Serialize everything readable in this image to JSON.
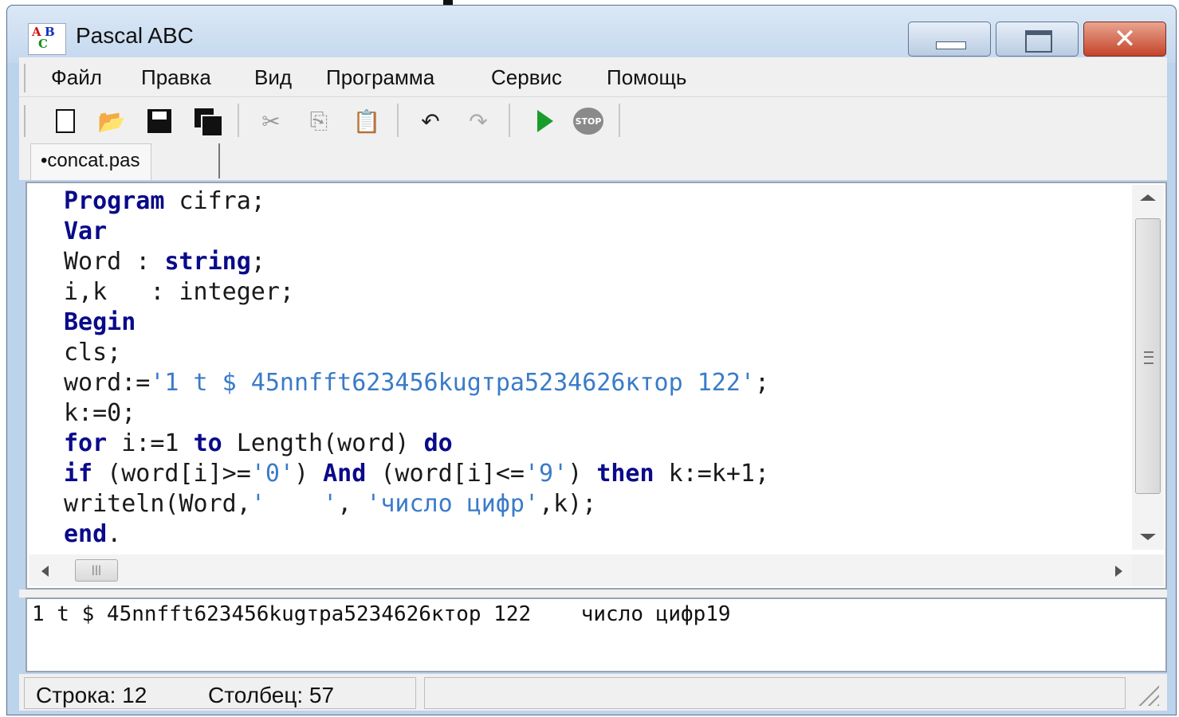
{
  "window": {
    "title": "Pascal ABC"
  },
  "menu": {
    "items": [
      "Файл",
      "Правка",
      "Вид",
      "Программа",
      "Сервис",
      "Помощь"
    ]
  },
  "toolbar": {
    "icons": [
      "new-file-icon",
      "open-file-icon",
      "save-icon",
      "save-all-icon",
      "cut-icon",
      "copy-icon",
      "paste-icon",
      "undo-icon",
      "redo-icon",
      "run-icon",
      "stop-icon"
    ],
    "stop_label": "STOP"
  },
  "tabs": [
    {
      "label": "concat.pas",
      "modified": true
    }
  ],
  "editor": {
    "lines": [
      {
        "k1": "Program",
        "t1": " cifra;"
      },
      {
        "k1": "Var"
      },
      {
        "t1": "Word : ",
        "k1": "string",
        "t2": ";"
      },
      {
        "t1": "i,k   : integer;"
      },
      {
        "k1": "Begin"
      },
      {
        "t1": "cls;"
      },
      {
        "t1": "word:=",
        "s1": "'1 t $ 45nnfft623456kugтра5234626ктор 122'",
        "t2": ";"
      },
      {
        "t1": "k:=0;"
      },
      {
        "k1": "for",
        "t1": " i:=1 ",
        "k2": "to",
        "t2": " Length(word) ",
        "k3": "do"
      },
      {
        "k1": "if",
        "t1": " (word[i]>=",
        "s1": "'0'",
        "t2": ") ",
        "k2": "And",
        "t3": " (word[i]<=",
        "s2": "'9'",
        "t4": ") ",
        "k3": "then",
        "t5": " k:=k+1;"
      },
      {
        "t1": "writeln(Word,",
        "s1": "'    '",
        "t2": ", ",
        "s2": "'число цифр'",
        "t3": ",k);"
      },
      {
        "k1": "end",
        "t1": "."
      }
    ]
  },
  "output": {
    "text": "1 t $ 45nnfft623456kugтра5234626ктор 122    число цифр19"
  },
  "statusbar": {
    "row": "Строка: 12",
    "col": "Столбец: 57"
  },
  "colors": {
    "keyword": "#0a0a8a",
    "string": "#3a7bc8",
    "titlebar": "#c4d8ee",
    "close_button": "#c4432a"
  }
}
